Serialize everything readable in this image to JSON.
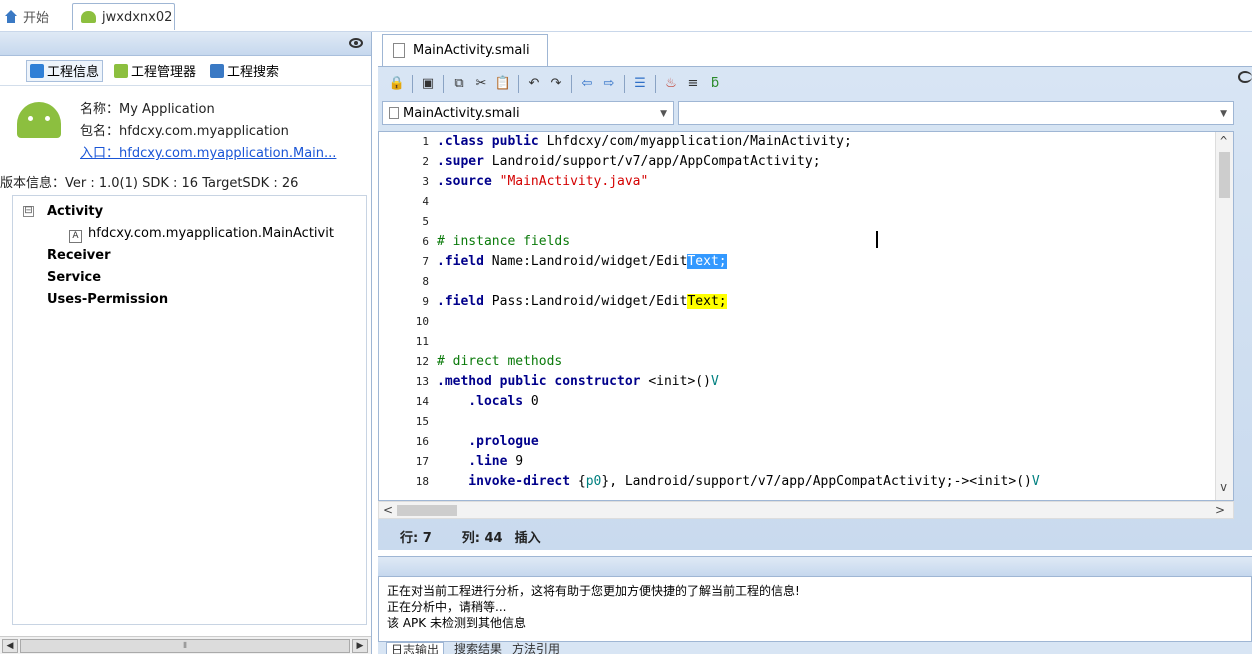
{
  "top_tabs": {
    "home": "开始",
    "project": "jwxdxnx02"
  },
  "left_panel": {
    "tabs": [
      "工程信息",
      "工程管理器",
      "工程搜索"
    ],
    "info": {
      "name_line": "名称：My Application",
      "package_line": "包名：hfdcxy.com.myapplication",
      "entry_line": "入口：hfdcxy.com.myapplication.Main..."
    },
    "version_line": "版本信息：Ver : 1.0(1) SDK : 16 TargetSDK : 26",
    "tree": {
      "activity": "Activity",
      "activity_child": "hfdcxy.com.myapplication.MainActivit",
      "activity_child_icon": "A",
      "receiver": "Receiver",
      "service": "Service",
      "uses_permission": "Uses-Permission"
    },
    "collapse_symbol": "⊟"
  },
  "editor": {
    "tab_label": "MainActivity.smali",
    "combo_file": "MainActivity.smali",
    "status": {
      "row": "行: 7",
      "col": "列: 44",
      "mode": "插入"
    },
    "lines": [
      {
        "n": "1",
        "parts": [
          [
            ".class public",
            "kw"
          ],
          [
            " Lhfdcxy/com/myapplication/MainActivity;",
            "tx"
          ]
        ]
      },
      {
        "n": "2",
        "parts": [
          [
            ".super",
            "kw"
          ],
          [
            " Landroid/support/v7/app/AppCompatActivity;",
            "tx"
          ]
        ]
      },
      {
        "n": "3",
        "parts": [
          [
            ".source",
            "kw"
          ],
          [
            " ",
            "tx"
          ],
          [
            "\"MainActivity.java\"",
            "str"
          ]
        ]
      },
      {
        "n": "4",
        "parts": []
      },
      {
        "n": "5",
        "parts": []
      },
      {
        "n": "6",
        "parts": [
          [
            "# instance fields",
            "cm"
          ]
        ]
      },
      {
        "n": "7",
        "parts": [
          [
            ".field",
            "kw"
          ],
          [
            " Name:Landroid/widget/Edit",
            "tx"
          ],
          [
            "Text;",
            "hl-blue"
          ]
        ]
      },
      {
        "n": "8",
        "parts": []
      },
      {
        "n": "9",
        "parts": [
          [
            ".field",
            "kw"
          ],
          [
            " Pass:Landroid/widget/Edit",
            "tx"
          ],
          [
            "Text;",
            "hl-yellow"
          ]
        ]
      },
      {
        "n": "10",
        "parts": []
      },
      {
        "n": "11",
        "parts": []
      },
      {
        "n": "12",
        "parts": [
          [
            "# direct methods",
            "cm"
          ]
        ]
      },
      {
        "n": "13",
        "parts": [
          [
            ".method public constructor",
            "kw"
          ],
          [
            " <init>()",
            "tx"
          ],
          [
            "V",
            "reg"
          ]
        ]
      },
      {
        "n": "14",
        "parts": [
          [
            "    .locals",
            "kw"
          ],
          [
            " 0",
            "tx"
          ]
        ]
      },
      {
        "n": "15",
        "parts": []
      },
      {
        "n": "16",
        "parts": [
          [
            "    .prologue",
            "kw"
          ]
        ]
      },
      {
        "n": "17",
        "parts": [
          [
            "    .line",
            "kw"
          ],
          [
            " 9",
            "tx"
          ]
        ]
      },
      {
        "n": "18",
        "parts": [
          [
            "    invoke-direct",
            "kw"
          ],
          [
            " {",
            "tx"
          ],
          [
            "p0",
            "reg"
          ],
          [
            "}, Landroid/support/v7/app/AppCompatActivity;-><init>()",
            "tx"
          ],
          [
            "V",
            "reg"
          ]
        ]
      }
    ]
  },
  "output": {
    "lines": [
      "正在对当前工程进行分析，这将有助于您更加方便快捷的了解当前工程的信息!",
      "正在分析中，请稍等...",
      "该 APK 未检测到其他信息"
    ],
    "tabs": [
      "日志输出",
      "搜索结果",
      "方法引用"
    ]
  },
  "colors": {
    "accent": "#3399ff",
    "highlight": "#ffff00",
    "frame": "#c9daee"
  }
}
